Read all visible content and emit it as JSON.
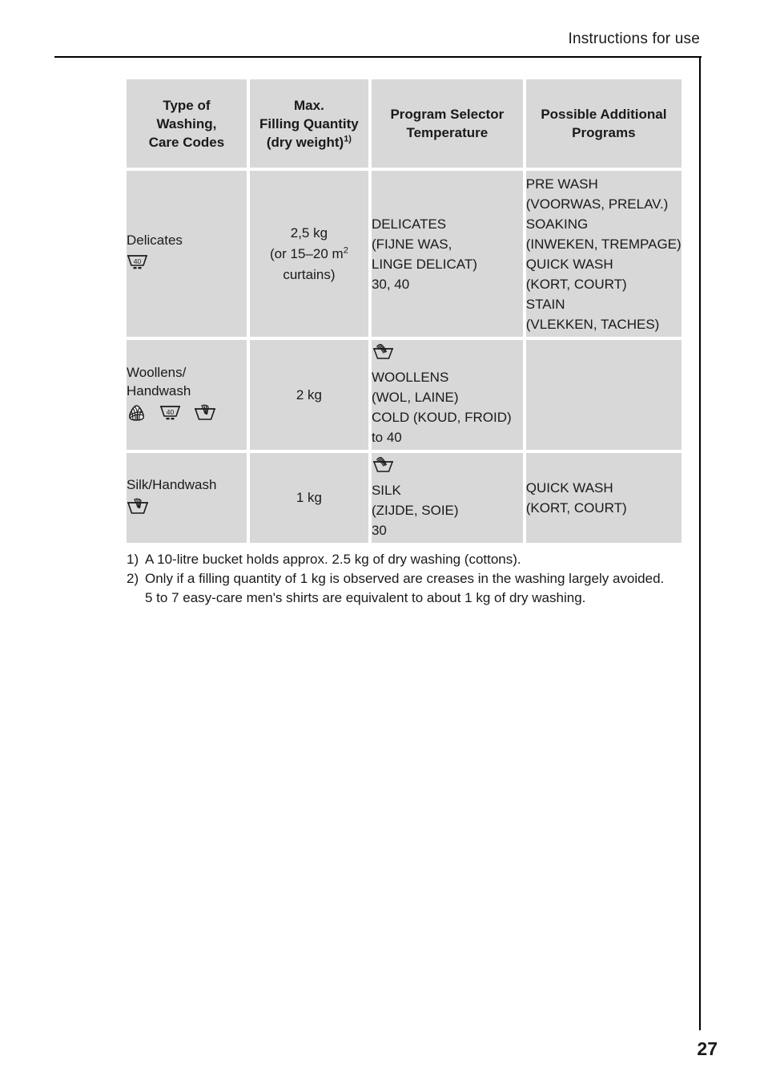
{
  "page": {
    "running_header": "Instructions for use",
    "page_number": "27"
  },
  "table": {
    "headers": [
      {
        "line1": "Type of",
        "line2": "Washing,",
        "line3": "Care Codes"
      },
      {
        "line1": "Max.",
        "line2": "Filling Quantity",
        "line3": "(dry weight)",
        "sup": "1)"
      },
      {
        "line1": "Program Selector",
        "line2": "Temperature"
      },
      {
        "line1": "Possible Additional",
        "line2": "Programs"
      }
    ],
    "rows": [
      {
        "type_label": "Delicates",
        "care_icons": [
          "washtub-40-delicate-icon"
        ],
        "quantity": [
          "2,5 kg",
          "(or 15–20 m",
          "curtains)"
        ],
        "quantity_sup": "2",
        "program_icon": null,
        "program": [
          "DELICATES",
          "(FIJNE WAS,",
          "LINGE DELICAT)",
          "30, 40"
        ],
        "additional": [
          "PRE WASH",
          "(VOORWAS, PRELAV.)",
          "SOAKING",
          "(INWEKEN, TREMPAGE)",
          "QUICK WASH",
          "(KORT, COURT)",
          "STAIN",
          "(VLEKKEN, TACHES)"
        ]
      },
      {
        "type_label": "Woollens/\nHandwash",
        "type_line1": "Woollens/",
        "type_line2": "Handwash",
        "care_icons": [
          "wool-skein-icon",
          "washtub-40-delicate-icon",
          "handwash-tub-icon"
        ],
        "quantity": [
          "2 kg"
        ],
        "program_icon": "handwash-tub-icon",
        "program": [
          "WOOLLENS",
          "(WOL, LAINE)",
          "COLD (KOUD, FROID)",
          "to 40"
        ],
        "additional": []
      },
      {
        "type_label": "Silk/Handwash",
        "care_icons": [
          "handwash-tub-icon"
        ],
        "quantity": [
          "1 kg"
        ],
        "program_icon": "handwash-tub-icon",
        "program": [
          "SILK",
          "(ZIJDE, SOIE)",
          "30"
        ],
        "additional": [
          "QUICK WASH",
          "(KORT, COURT)"
        ]
      }
    ]
  },
  "footnotes": [
    {
      "marker": "1)",
      "text": "A 10-litre bucket holds approx. 2.5 kg of dry washing (cottons)."
    },
    {
      "marker": "2)",
      "text": "Only if a filling quantity of 1 kg is observed are creases in the washing largely avoided.",
      "extra": "5 to 7 easy-care men's shirts are equivalent to about 1 kg of dry washing."
    }
  ],
  "colors": {
    "cell_background": "#d8d8d8",
    "rule": "#000000",
    "text": "#1a1a1a"
  }
}
